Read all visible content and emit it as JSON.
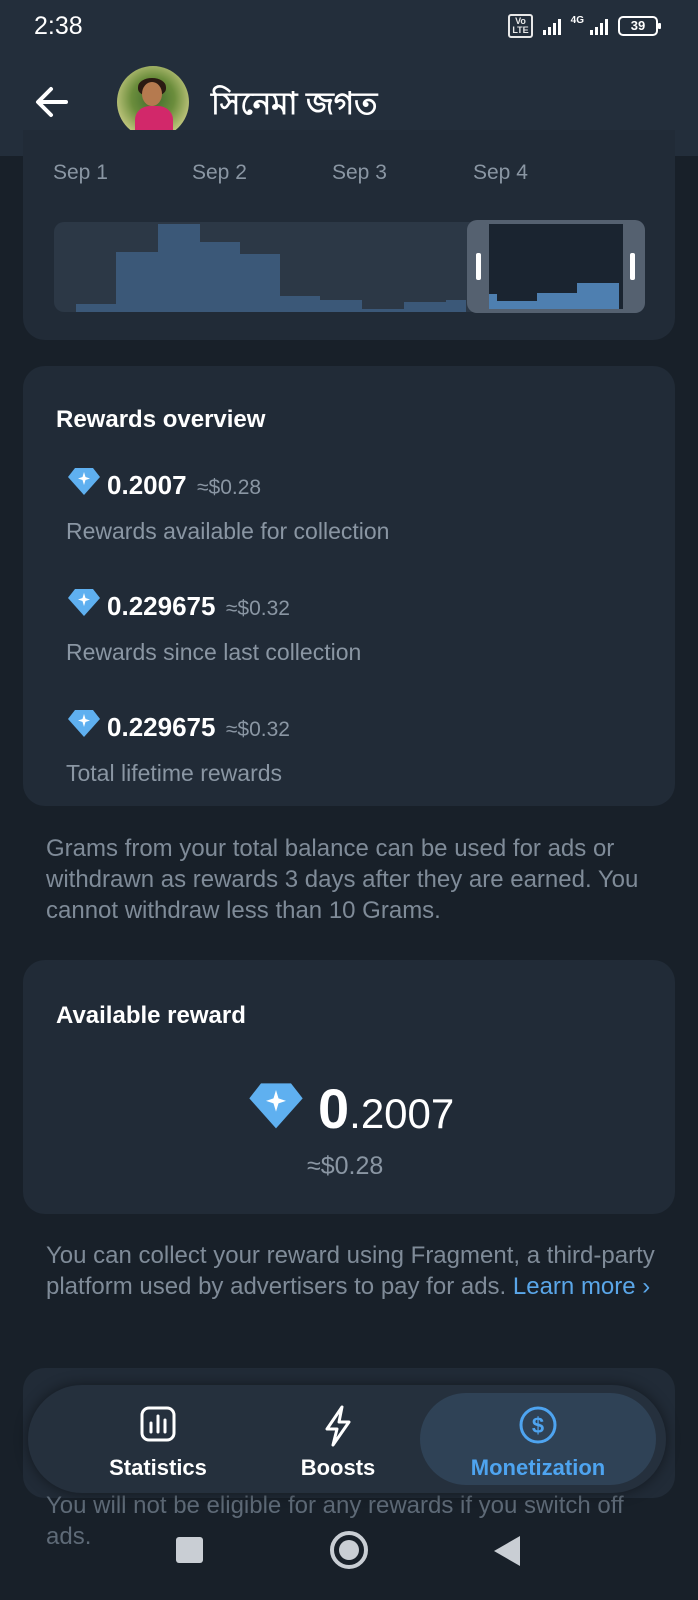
{
  "status_bar": {
    "time": "2:38",
    "volte": "Vo LTE",
    "network": "4G",
    "battery": "39"
  },
  "header": {
    "title": "সিনেমা জগত"
  },
  "chart": {
    "dates": [
      "Sep 1",
      "Sep 2",
      "Sep 3",
      "Sep 4"
    ]
  },
  "rewards_overview": {
    "title": "Rewards overview",
    "items": [
      {
        "amount_int": "0",
        "amount_frac": ".2007",
        "approx": "≈$0.28",
        "label": "Rewards available for collection"
      },
      {
        "amount_int": "0",
        "amount_frac": ".229675",
        "approx": "≈$0.32",
        "label": "Rewards since last collection"
      },
      {
        "amount_int": "0",
        "amount_frac": ".229675",
        "approx": "≈$0.32",
        "label": "Total lifetime rewards"
      }
    ]
  },
  "grams_note": "Grams from your total balance can be used for ads or withdrawn as rewards 3 days after they are earned. You cannot withdraw less than 10 Grams.",
  "available_reward": {
    "title": "Available reward",
    "amount_int": "0",
    "amount_frac": ".2007",
    "approx": "≈$0.28"
  },
  "fragment_note": {
    "text": "You can collect your reward using Fragment, a third-party platform used by advertisers to pay for ads.",
    "link": "Learn more",
    "link_arrow": "›"
  },
  "tabs": [
    {
      "label": "Statistics",
      "icon": "chart-icon",
      "active": false
    },
    {
      "label": "Boosts",
      "icon": "lightning-icon",
      "active": false
    },
    {
      "label": "Monetization",
      "icon": "dollar-coin-icon",
      "active": true
    }
  ],
  "switch_off_note": "You will not be eligible for any rewards if you switch off ads.",
  "colors": {
    "accent": "#4ea4f0",
    "background": "#182029",
    "card": "#212b37",
    "header": "#232e3b",
    "diamond": "#5fb0f0"
  }
}
